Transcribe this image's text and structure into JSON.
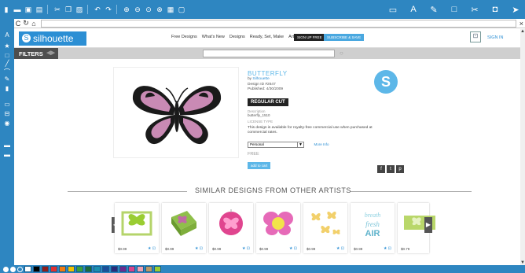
{
  "toolbar": {
    "left_icons": [
      "new-file-icon",
      "open-icon",
      "save-icon",
      "print-icon",
      "cut-icon",
      "copy-icon",
      "paste-icon",
      "undo-icon",
      "redo-icon",
      "zoom-in-icon",
      "zoom-out-icon",
      "zoom-fit-icon",
      "zoom-select-icon",
      "grid-icon",
      "page-icon"
    ],
    "right_icons": [
      "library-icon",
      "text-style-icon",
      "pen-icon",
      "page-settings-icon",
      "cut-settings-icon",
      "store-icon",
      "send-icon"
    ]
  },
  "address": {
    "back": "C",
    "close": "×"
  },
  "site": {
    "logo": "silhouette",
    "nav": [
      "Free Designs",
      "What's New",
      "Designs",
      "Ready, Set, Make",
      "Artists"
    ],
    "sign_up": "SIGN UP FREE",
    "subscribe": "SUBSCRIBE & SAVE",
    "sign_in": "SIGN IN"
  },
  "filterbar": {
    "label": "FILTERS"
  },
  "product": {
    "title": "BUTTERFLY",
    "by_prefix": "by ",
    "by_link": "Silhouette",
    "design_id": "Design ID #2647",
    "published": "Published: 4/30/2009",
    "cut_type": "REGULAR CUT",
    "description_label": "Description",
    "description_value": "butterfly_1510",
    "license_label": "LICENSE TYPE",
    "license_text": "This design is available for royalty-free commercial use when purchased at commercial rates.",
    "license_selected": "Personal",
    "more_info": "More Info",
    "price": "FREE",
    "add_to_cart": "add to cart"
  },
  "similar": {
    "heading": "SIMILAR DESIGNS FROM OTHER ARTISTS",
    "items": [
      {
        "price": "$0.99"
      },
      {
        "price": "$0.99"
      },
      {
        "price": "$0.99"
      },
      {
        "price": "$0.99"
      },
      {
        "price": "$0.99"
      },
      {
        "price": "$0.99"
      },
      {
        "price": "$0.79"
      }
    ]
  },
  "colors": {
    "chrome": "#2e86c1",
    "accent": "#5db7e8",
    "palette": [
      "#ffffff",
      "#000000",
      "#8c1d1d",
      "#e03030",
      "#f07a10",
      "#f2c200",
      "#3aa03a",
      "#1d6b3a",
      "#1a8fb0",
      "#1b4e9b",
      "#2b2b7a",
      "#6d2b8f",
      "#d9428b",
      "#f0a0b0",
      "#bb9966",
      "#9acd32"
    ]
  }
}
